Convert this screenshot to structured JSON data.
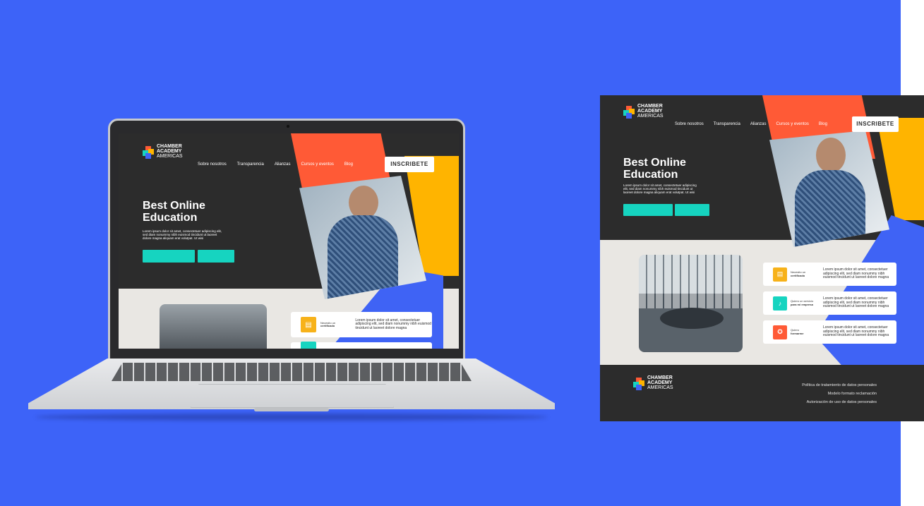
{
  "brand": {
    "line1": "CHAMBER",
    "line2": "ACADEMY",
    "line3": "AMERICAS"
  },
  "nav": {
    "items": [
      "Sobre nosotros",
      "Transparencia",
      "Alianzas",
      "Cursos y eventos",
      "Blog"
    ],
    "cta": "INSCRIBETE"
  },
  "hero": {
    "title_line1": "Best Online",
    "title_line2": "Education",
    "body": "Lorem ipsum dolor sit amet, consectetuer adipiscing elit, sed diam nonummy nibh euismod tincidunt ut laoreet dolore magna aliquam erat volutpat. Ut wisi"
  },
  "features": [
    {
      "label_small": "Necesito un",
      "label_bold": "certificado",
      "icon": "certificate-icon",
      "color": "#f7b21a",
      "text": "Lorem ipsum dolor sit amet, consectetuer adipiscing elit, sed diam nonummy nibh euismod tincidunt ut laoreet dolore magna"
    },
    {
      "label_small": "Quiero un servicio",
      "label_bold": "para mi empresa",
      "icon": "microphone-icon",
      "color": "#16d4c0",
      "text": "Lorem ipsum dolor sit amet, consectetuer adipiscing elit, sed diam nonummy nibh euismod tincidunt ut laoreet dolore magna"
    },
    {
      "label_small": "Quiero",
      "label_bold": "formarme",
      "icon": "award-icon",
      "color": "#ff5a36",
      "text": "Lorem ipsum dolor sit amet, consectetuer adipiscing elit, sed diam nonummy nibh euismod tincidunt ut laoreet dolore magna"
    }
  ],
  "footer": {
    "links": [
      "Política de tratamiento de datos personales",
      "Modelo formato reclamación",
      "Autorización de uso de datos personales"
    ]
  },
  "colors": {
    "background": "#3d63f8",
    "dark": "#2c2c2c",
    "orange": "#ff5a36",
    "yellow": "#ffb400",
    "blue": "#3f63f5",
    "teal": "#16d4c0"
  }
}
